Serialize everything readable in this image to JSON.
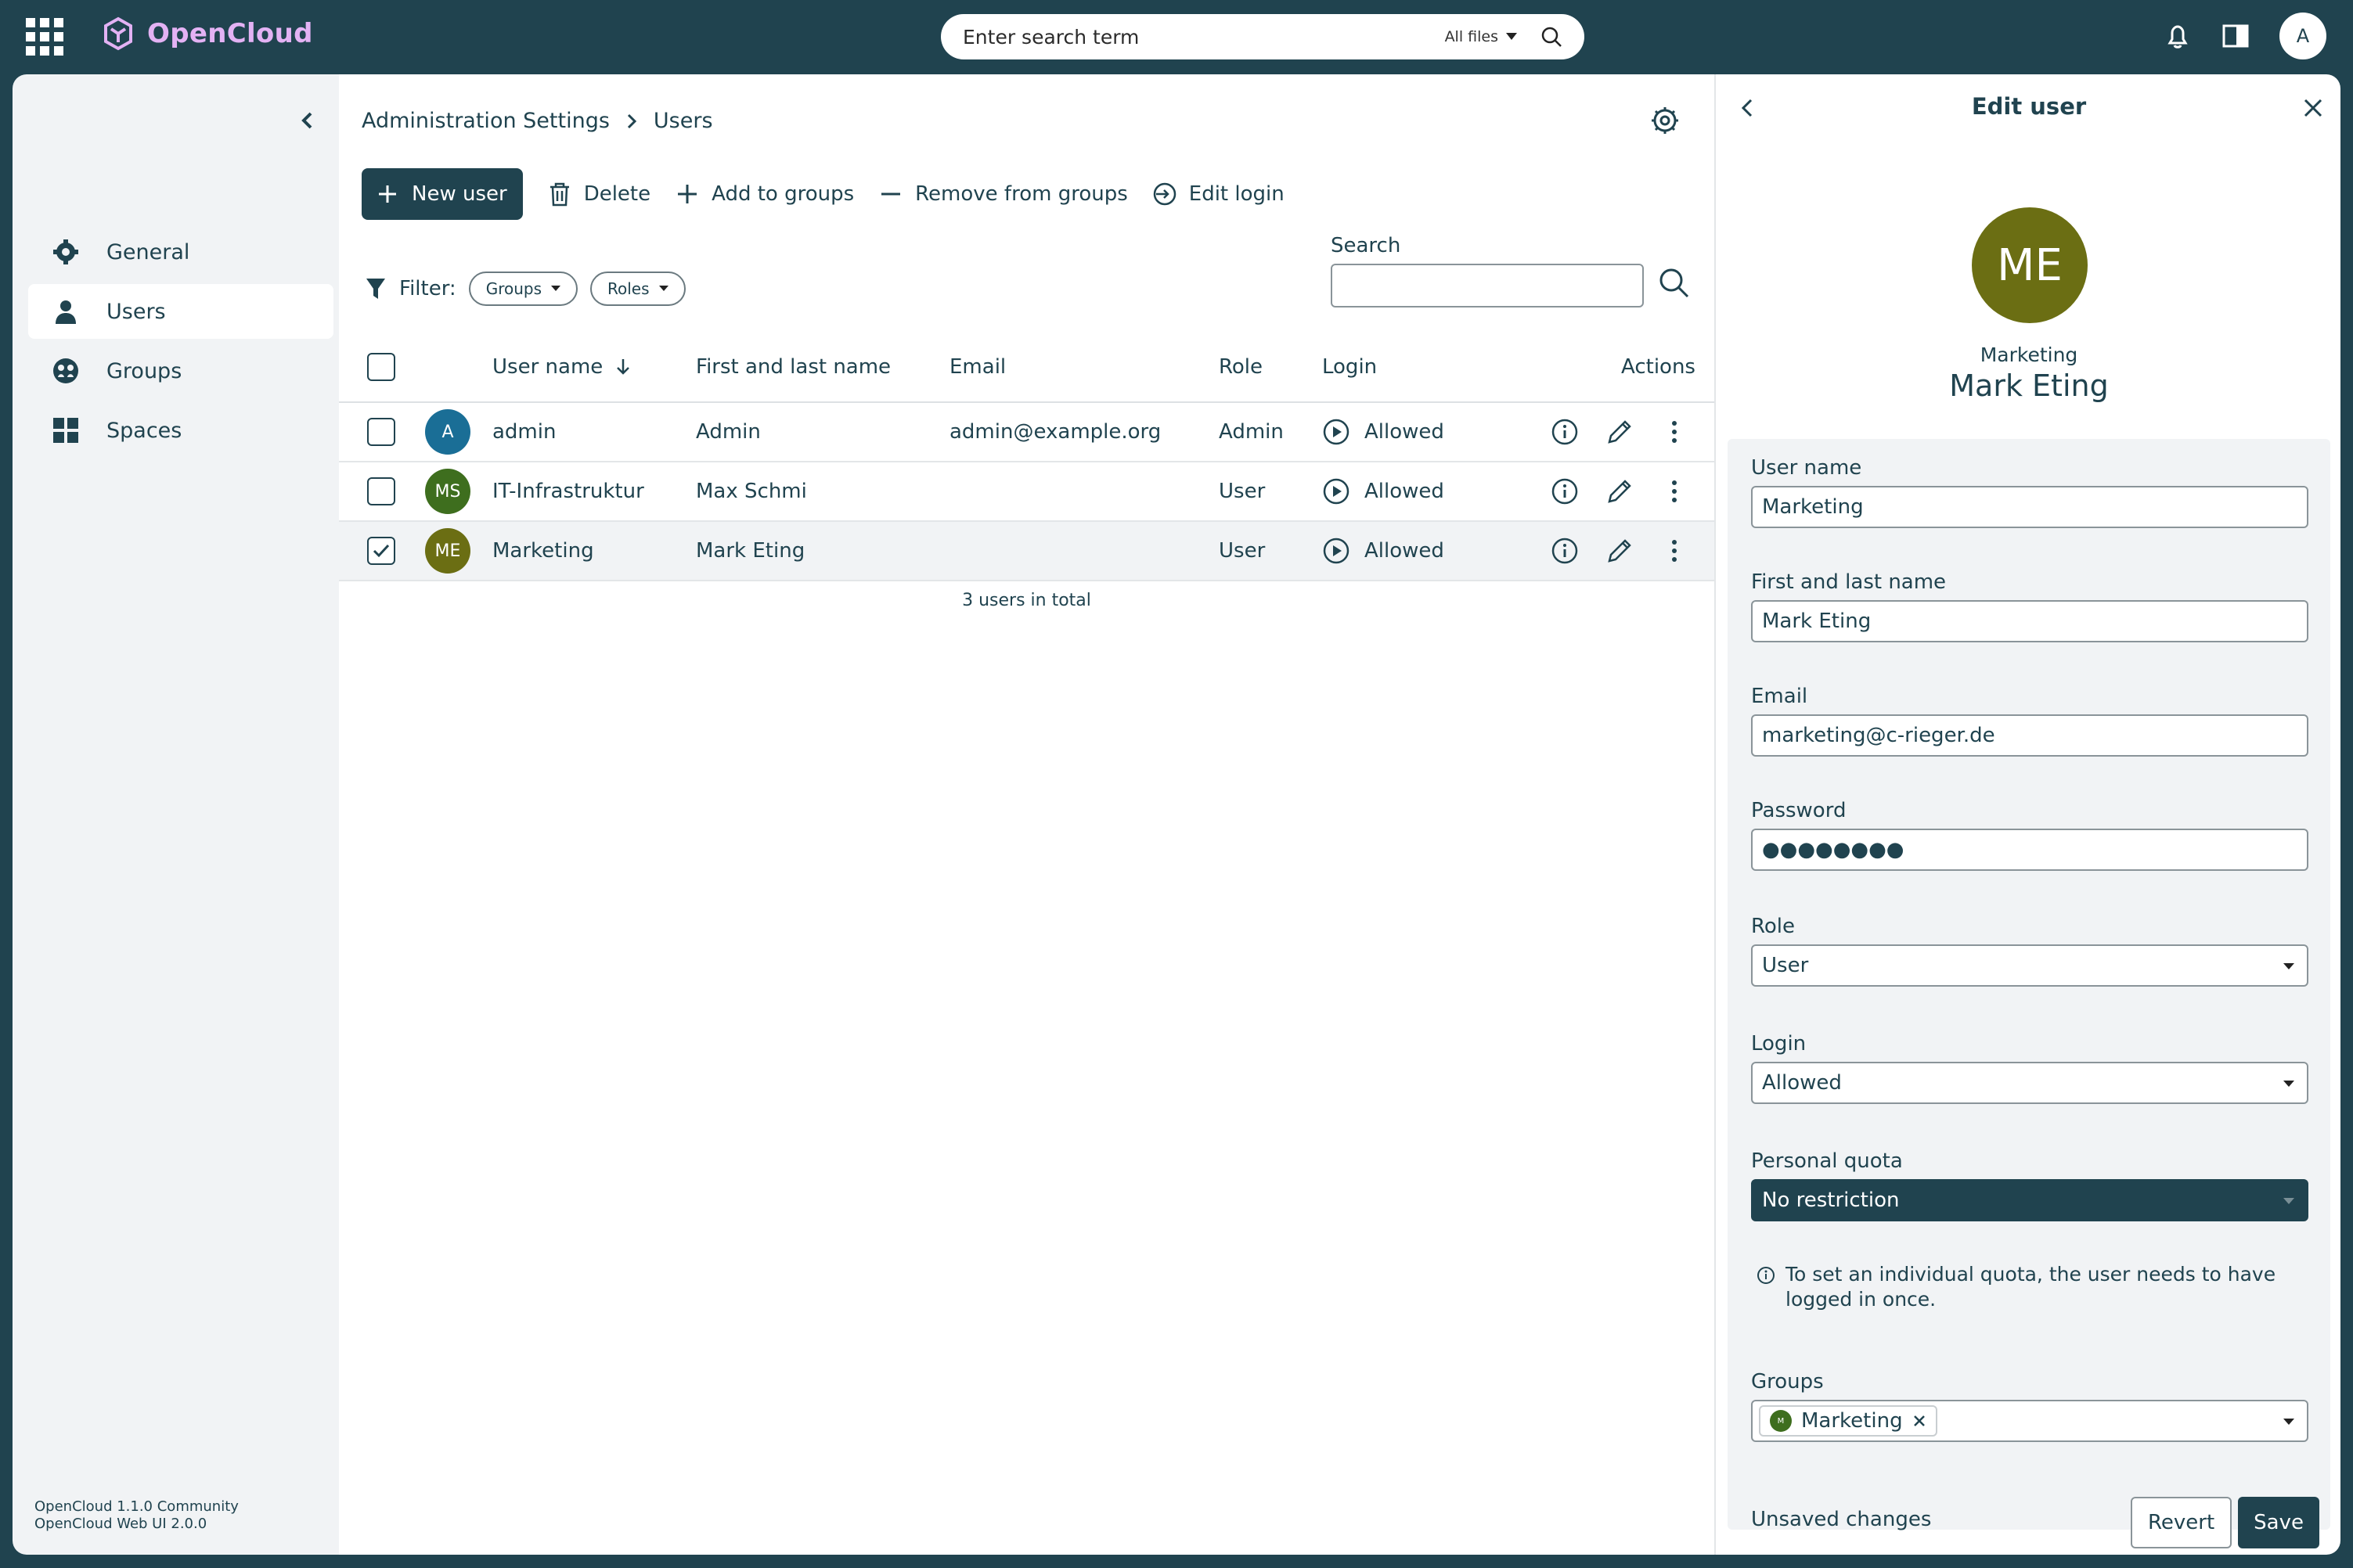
{
  "app": {
    "name": "OpenCloud"
  },
  "search": {
    "placeholder": "Enter search term",
    "scope": "All files"
  },
  "topbar": {
    "avatar_initial": "A"
  },
  "sidebar": {
    "items": [
      {
        "label": "General",
        "icon": "gear-icon"
      },
      {
        "label": "Users",
        "icon": "user-icon",
        "active": true
      },
      {
        "label": "Groups",
        "icon": "groups-icon"
      },
      {
        "label": "Spaces",
        "icon": "grid-icon"
      }
    ],
    "version_line1": "OpenCloud 1.1.0 Community",
    "version_line2": "OpenCloud Web UI 2.0.0"
  },
  "breadcrumb": {
    "parent": "Administration Settings",
    "current": "Users"
  },
  "toolbar": {
    "new_user": "New user",
    "delete": "Delete",
    "add_to_groups": "Add to groups",
    "remove_from_groups": "Remove from groups",
    "edit_login": "Edit login"
  },
  "filter": {
    "label": "Filter:",
    "groups": "Groups",
    "roles": "Roles"
  },
  "table_search": {
    "label": "Search",
    "value": ""
  },
  "table": {
    "headers": {
      "user_name": "User name",
      "name": "First and last name",
      "email": "Email",
      "role": "Role",
      "login": "Login",
      "actions": "Actions"
    },
    "rows": [
      {
        "initials": "A",
        "avatar_color": "#1a6e96",
        "username": "admin",
        "name": "Admin",
        "email": "admin@example.org",
        "role": "Admin",
        "login": "Allowed",
        "checked": false
      },
      {
        "initials": "MS",
        "avatar_color": "#3e6e1e",
        "username": "IT-Infrastruktur",
        "name": "Max Schmi",
        "email": "",
        "role": "User",
        "login": "Allowed",
        "checked": false
      },
      {
        "initials": "ME",
        "avatar_color": "#6b6e13",
        "username": "Marketing",
        "name": "Mark Eting",
        "email": "",
        "role": "User",
        "login": "Allowed",
        "checked": true
      }
    ],
    "total": "3 users in total"
  },
  "panel": {
    "title": "Edit user",
    "initials": "ME",
    "username": "Marketing",
    "display_name": "Mark Eting",
    "fields": {
      "user_name_label": "User name",
      "user_name": "Marketing",
      "name_label": "First and last name",
      "name": "Mark Eting",
      "email_label": "Email",
      "email": "marketing@c-rieger.de",
      "password_label": "Password",
      "password": "●●●●●●●●",
      "role_label": "Role",
      "role": "User",
      "login_label": "Login",
      "login": "Allowed",
      "quota_label": "Personal quota",
      "quota": "No restriction",
      "quota_hint": "To set an individual quota, the user needs to have logged in once.",
      "groups_label": "Groups",
      "group_chip": "Marketing",
      "group_chip_initial": "M"
    },
    "unsaved": "Unsaved changes",
    "revert": "Revert",
    "save": "Save"
  }
}
